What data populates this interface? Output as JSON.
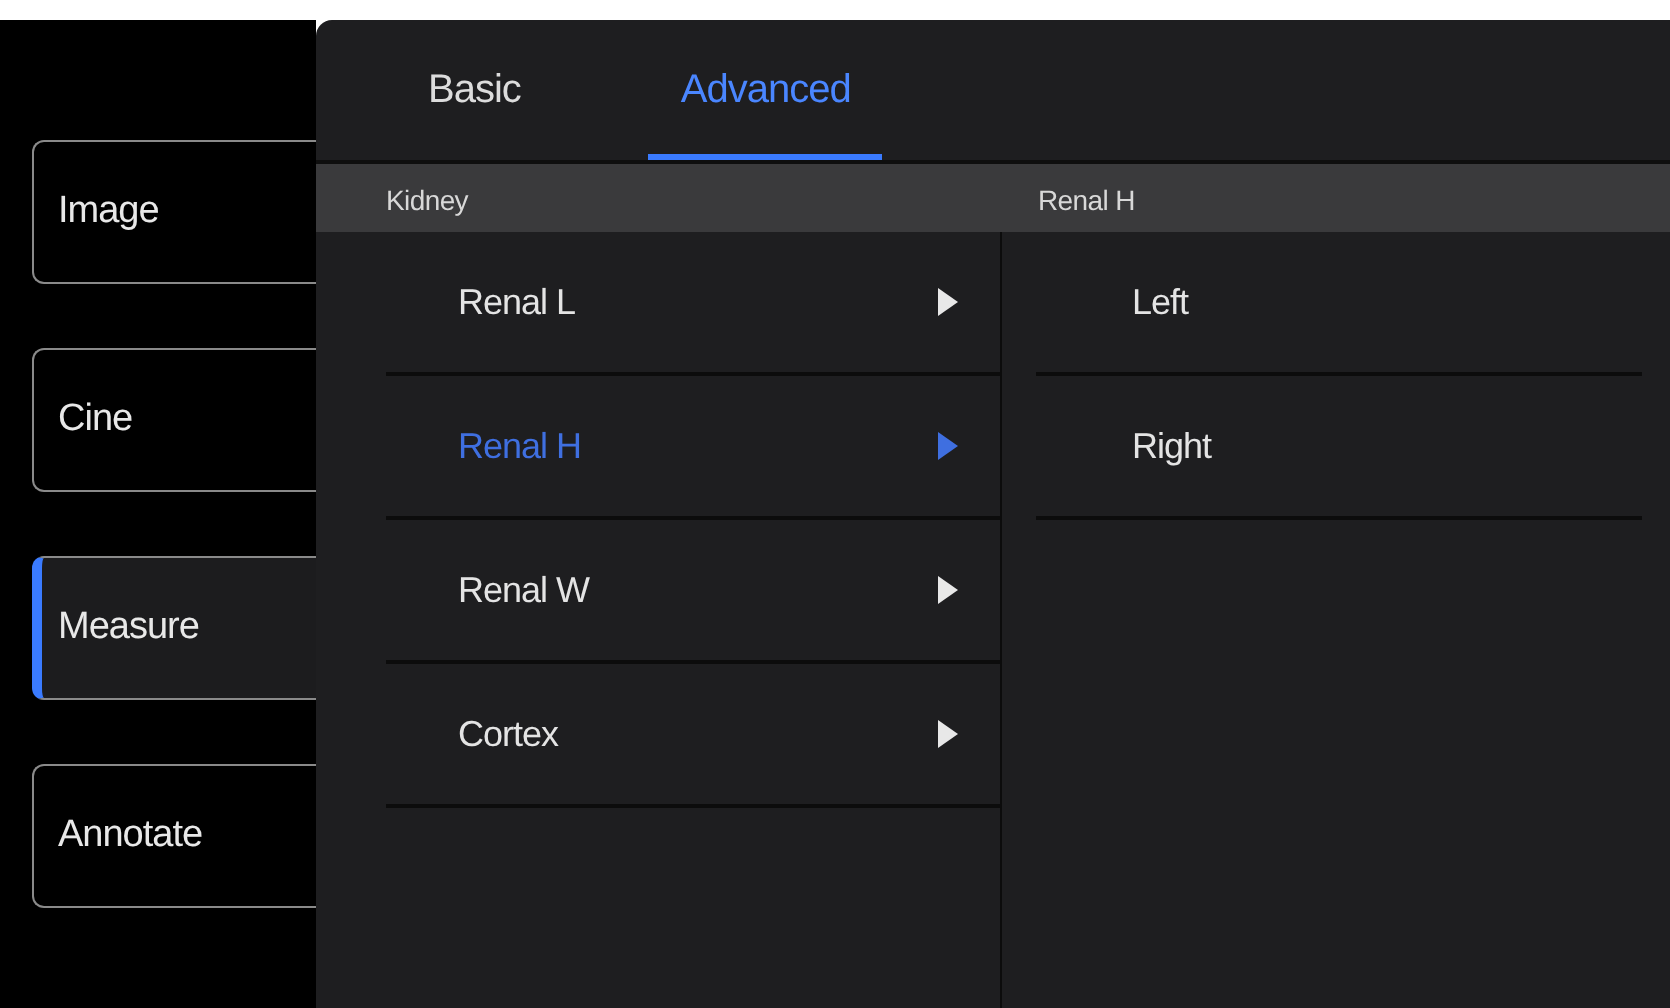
{
  "sidebar": {
    "items": [
      {
        "label": "Image",
        "selected": false
      },
      {
        "label": "Cine",
        "selected": false
      },
      {
        "label": "Measure",
        "selected": true
      },
      {
        "label": "Annotate",
        "selected": false
      }
    ]
  },
  "tabs": [
    {
      "label": "Basic",
      "selected": false
    },
    {
      "label": "Advanced",
      "selected": true
    }
  ],
  "left_list": {
    "header": "Kidney",
    "items": [
      {
        "label": "Renal L",
        "selected": false
      },
      {
        "label": "Renal H",
        "selected": true
      },
      {
        "label": "Renal W",
        "selected": false
      },
      {
        "label": "Cortex",
        "selected": false
      }
    ]
  },
  "right_list": {
    "header": "Renal H",
    "items": [
      {
        "label": "Left",
        "selected": false
      },
      {
        "label": "Right",
        "selected": false
      }
    ]
  }
}
